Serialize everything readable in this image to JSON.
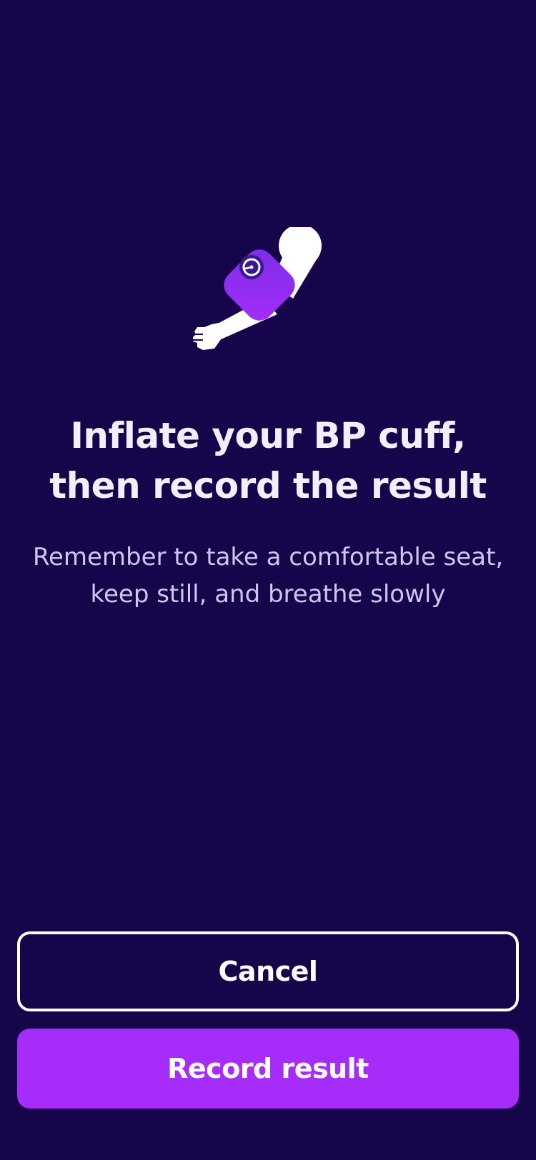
{
  "illustration": {
    "icon": "bp-cuff-arm-icon",
    "colors": {
      "arm": "#ffffff",
      "cuff": "#8a2cf0",
      "gauge": "#3a1794"
    }
  },
  "content": {
    "title_line1": "Inflate your BP cuff,",
    "title_line2": "then record the result",
    "subtitle_line1": "Remember to take a comfortable seat,",
    "subtitle_line2": "keep still, and breathe slowly"
  },
  "actions": {
    "cancel_label": "Cancel",
    "record_label": "Record result"
  },
  "colors": {
    "background": "#17054c",
    "primary": "#a62cfa",
    "title_text": "#f2eefc",
    "subtitle_text": "#cfc5ee"
  }
}
